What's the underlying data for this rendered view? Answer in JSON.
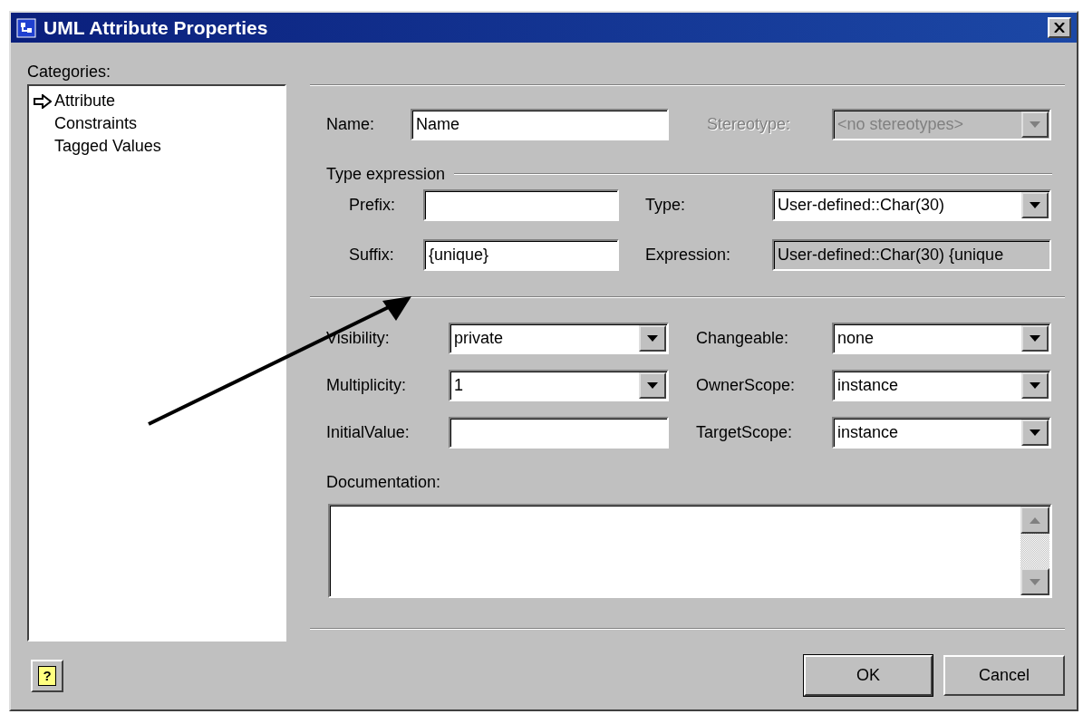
{
  "window": {
    "title": "UML Attribute Properties"
  },
  "categories": {
    "label": "Categories:",
    "items": [
      {
        "label": "Attribute",
        "selected": true
      },
      {
        "label": "Constraints",
        "selected": false
      },
      {
        "label": "Tagged Values",
        "selected": false
      }
    ]
  },
  "general": [
    {
      "label": "Name:",
      "kind": "text",
      "value": "Name",
      "disabled": false
    },
    {
      "label": "Stereotype:",
      "kind": "combo",
      "value": "<no stereotypes>",
      "disabled": true
    }
  ],
  "type_expression": {
    "title": "Type expression",
    "fields": [
      {
        "label": "Prefix:",
        "kind": "text",
        "disabled": false
      },
      {
        "label": "Type:",
        "kind": "combo",
        "value": "User-defined::Char(30)",
        "disabled": false
      },
      {
        "label": "Suffix:",
        "kind": "text",
        "value": "{unique}",
        "disabled": false
      },
      {
        "label": "Expression:",
        "kind": "readonly",
        "value": "User-defined::Char(30) {unique",
        "disabled": false
      }
    ]
  },
  "properties": [
    {
      "label": "Visibility:",
      "kind": "combo",
      "value": "private",
      "disabled": false
    },
    {
      "label": "Changeable:",
      "kind": "combo",
      "value": "none",
      "disabled": false
    },
    {
      "label": "Multiplicity:",
      "kind": "combo",
      "value": "1",
      "disabled": false
    },
    {
      "label": "OwnerScope:",
      "kind": "combo",
      "value": "instance",
      "disabled": false
    },
    {
      "label": "InitialValue:",
      "kind": "text",
      "disabled": false
    },
    {
      "label": "TargetScope:",
      "kind": "combo",
      "value": "instance",
      "disabled": false
    }
  ],
  "documentation": {
    "label": "Documentation:"
  },
  "help_button": "?",
  "buttons": [
    {
      "label": "OK",
      "default": true
    },
    {
      "label": "Cancel",
      "default": false
    }
  ]
}
